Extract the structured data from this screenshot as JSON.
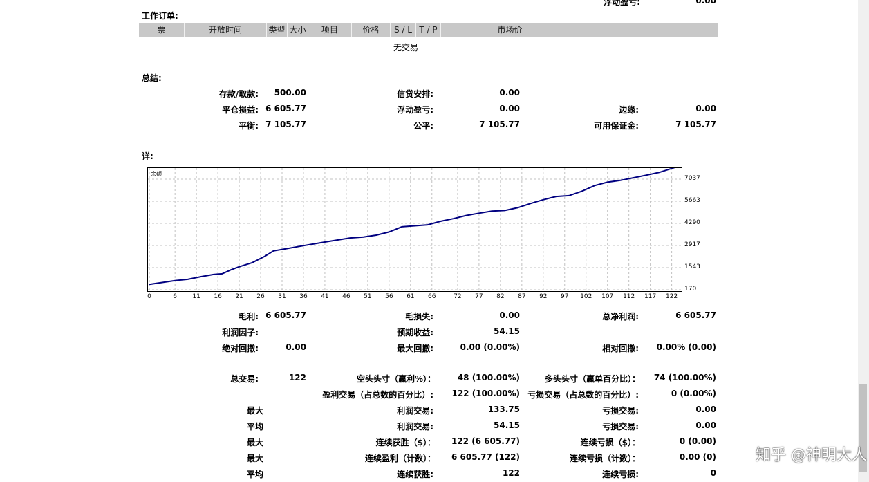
{
  "top_partial": {
    "label": "浮动盈亏:",
    "value": "0.00"
  },
  "orders": {
    "title": "工作订单:",
    "columns": [
      "票",
      "开放时间",
      "类型",
      "大小",
      "项目",
      "价格",
      "S / L",
      "T / P",
      "市场价",
      ""
    ],
    "empty_text": "无交易"
  },
  "summary": {
    "title": "总结:",
    "rows": [
      [
        {
          "label": "存款/取款:",
          "value": "500.00"
        },
        {
          "label": "信贷安排:",
          "value": "0.00"
        },
        {
          "label": "",
          "value": ""
        }
      ],
      [
        {
          "label": "平仓损益:",
          "value": "6 605.77"
        },
        {
          "label": "浮动盈亏:",
          "value": "0.00"
        },
        {
          "label": "边缘:",
          "value": "0.00"
        }
      ],
      [
        {
          "label": "平衡:",
          "value": "7 105.77"
        },
        {
          "label": "公平:",
          "value": "7 105.77"
        },
        {
          "label": "可用保证金:",
          "value": "7 105.77"
        }
      ]
    ]
  },
  "details_title": "详:",
  "chart_data": {
    "type": "line",
    "title": "余额",
    "xlabel": "",
    "ylabel": "",
    "x_ticks": [
      0,
      6,
      11,
      16,
      21,
      26,
      31,
      36,
      41,
      46,
      51,
      56,
      61,
      66,
      72,
      77,
      82,
      87,
      92,
      97,
      102,
      107,
      112,
      117,
      122
    ],
    "y_ticks": [
      170,
      1543,
      2917,
      4290,
      5663,
      7037
    ],
    "xlim": [
      0,
      124
    ],
    "ylim": [
      170,
      7037
    ],
    "grid": true,
    "line_color": "#000080",
    "series": [
      {
        "x": [
          0,
          3,
          6,
          9,
          12,
          15,
          17,
          19,
          21,
          24,
          27,
          29,
          32,
          35,
          38,
          41,
          44,
          47,
          50,
          53,
          56,
          59,
          62,
          65,
          68,
          71,
          74,
          77,
          80,
          83,
          86,
          89,
          92,
          95,
          98,
          101,
          104,
          107,
          110,
          113,
          116,
          119,
          122,
          124
        ],
        "y": [
          500,
          620,
          740,
          820,
          980,
          1120,
          1160,
          1400,
          1600,
          1850,
          2250,
          2580,
          2720,
          2860,
          3000,
          3130,
          3260,
          3390,
          3440,
          3560,
          3760,
          4080,
          4140,
          4200,
          4420,
          4580,
          4780,
          4920,
          5050,
          5090,
          5260,
          5520,
          5760,
          5960,
          6010,
          6280,
          6640,
          6850,
          6960,
          7120,
          7280,
          7450,
          7700,
          7880
        ]
      }
    ]
  },
  "details": {
    "row1": [
      {
        "label": "毛利:",
        "value": "6 605.77"
      },
      {
        "label": "毛损失:",
        "value": "0.00"
      },
      {
        "label": "总净利润:",
        "value": "6 605.77"
      }
    ],
    "row2": [
      {
        "label": "利润因子:",
        "value": ""
      },
      {
        "label": "预期收益:",
        "value": "54.15"
      }
    ],
    "row3": [
      {
        "label": "绝对回撤:",
        "value": "0.00"
      },
      {
        "label": "最大回撤:",
        "value": "0.00 (0.00%)"
      },
      {
        "label": "相对回撤:",
        "value": "0.00% (0.00)"
      }
    ],
    "row4": [
      {
        "label": "总交易:",
        "value": "122"
      },
      {
        "label": "空头头寸（赢利%）：",
        "value": "48 (100.00%)"
      },
      {
        "label": "多头头寸（赢单百分比）：",
        "value": "74 (100.00%)"
      }
    ],
    "row5": [
      {
        "label": "盈利交易（占总数的百分比）:",
        "value": "122 (100.00%)"
      },
      {
        "label": "亏损交易（占总数的百分比）:",
        "value": "0 (0.00%)"
      }
    ],
    "row6": [
      {
        "label": "最大",
        "value": ""
      },
      {
        "label": "利润交易:",
        "value": "133.75"
      },
      {
        "label": "亏损交易:",
        "value": "0.00"
      }
    ],
    "row7": [
      {
        "label": "平均",
        "value": ""
      },
      {
        "label": "利润交易:",
        "value": "54.15"
      },
      {
        "label": "亏损交易:",
        "value": "0.00"
      }
    ],
    "row8": [
      {
        "label": "最大",
        "value": ""
      },
      {
        "label": "连续获胜（$）：",
        "value": "122 (6 605.77)"
      },
      {
        "label": "连续亏损（$）：",
        "value": "0 (0.00)"
      }
    ],
    "row9": [
      {
        "label": "最大",
        "value": ""
      },
      {
        "label": "连续盈利（计数）：",
        "value": "6 605.77 (122)"
      },
      {
        "label": "连续亏损（计数）：",
        "value": "0.00 (0)"
      }
    ],
    "row10": [
      {
        "label": "平均",
        "value": ""
      },
      {
        "label": "连续获胜:",
        "value": "122"
      },
      {
        "label": "连续亏损:",
        "value": "0"
      }
    ]
  },
  "watermark": "知乎 @神明大人"
}
